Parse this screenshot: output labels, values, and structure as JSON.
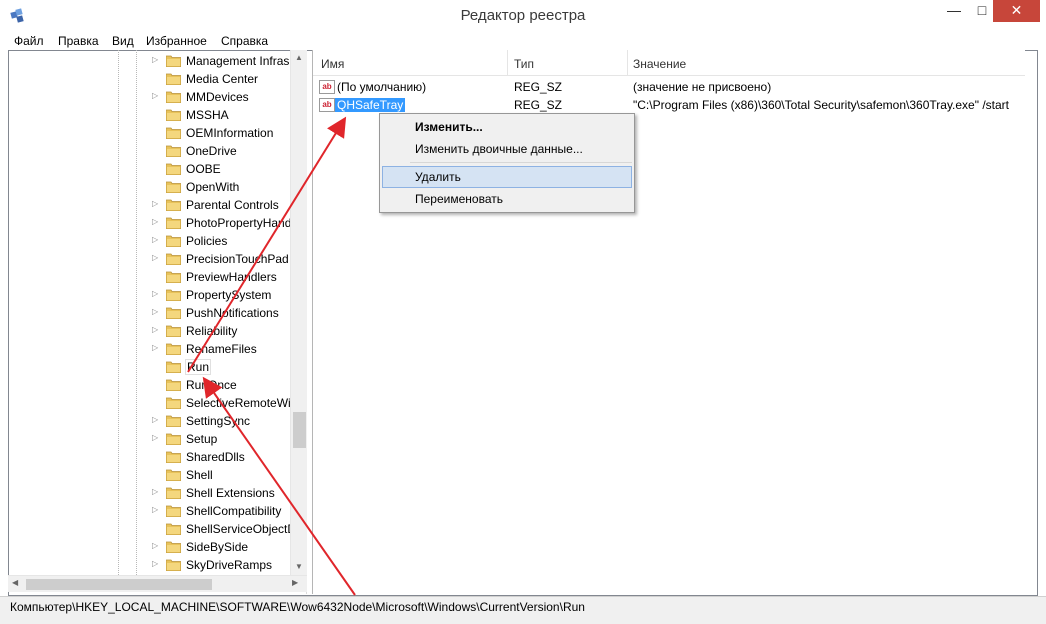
{
  "window": {
    "title": "Редактор реестра",
    "controls": {
      "minimize": "—",
      "maximize": "□",
      "close": "✕"
    }
  },
  "menu": [
    "Файл",
    "Правка",
    "Вид",
    "Избранное",
    "Справка"
  ],
  "tree": {
    "items": [
      {
        "label": "Management Infras",
        "expandable": true
      },
      {
        "label": "Media Center",
        "expandable": false
      },
      {
        "label": "MMDevices",
        "expandable": true
      },
      {
        "label": "MSSHA",
        "expandable": false
      },
      {
        "label": "OEMInformation",
        "expandable": false
      },
      {
        "label": "OneDrive",
        "expandable": false
      },
      {
        "label": "OOBE",
        "expandable": false
      },
      {
        "label": "OpenWith",
        "expandable": false
      },
      {
        "label": "Parental Controls",
        "expandable": true
      },
      {
        "label": "PhotoPropertyHand",
        "expandable": true
      },
      {
        "label": "Policies",
        "expandable": true
      },
      {
        "label": "PrecisionTouchPad",
        "expandable": true
      },
      {
        "label": "PreviewHandlers",
        "expandable": false
      },
      {
        "label": "PropertySystem",
        "expandable": true
      },
      {
        "label": "PushNotifications",
        "expandable": true
      },
      {
        "label": "Reliability",
        "expandable": true
      },
      {
        "label": "RenameFiles",
        "expandable": true
      },
      {
        "label": "Run",
        "expandable": false,
        "selected": true
      },
      {
        "label": "RunOnce",
        "expandable": false
      },
      {
        "label": "SelectiveRemoteWip",
        "expandable": false
      },
      {
        "label": "SettingSync",
        "expandable": true
      },
      {
        "label": "Setup",
        "expandable": true
      },
      {
        "label": "SharedDlls",
        "expandable": false
      },
      {
        "label": "Shell",
        "expandable": false
      },
      {
        "label": "Shell Extensions",
        "expandable": true
      },
      {
        "label": "ShellCompatibility",
        "expandable": true
      },
      {
        "label": "ShellServiceObjectD",
        "expandable": false
      },
      {
        "label": "SideBySide",
        "expandable": true
      },
      {
        "label": "SkyDriveRamps",
        "expandable": true
      }
    ]
  },
  "list": {
    "columns": [
      "Имя",
      "Тип",
      "Значение"
    ],
    "rows": [
      {
        "name": "(По умолчанию)",
        "type": "REG_SZ",
        "value": "(значение не присвоено)",
        "icon": "ab"
      },
      {
        "name": "QHSafeTray",
        "type": "REG_SZ",
        "value": "\"C:\\Program Files (x86)\\360\\Total Security\\safemon\\360Tray.exe\" /start",
        "icon": "ab",
        "selected": true
      }
    ]
  },
  "context_menu": {
    "items": [
      "Изменить...",
      "Изменить двоичные данные...",
      "Удалить",
      "Переименовать"
    ],
    "highlighted": "Удалить"
  },
  "status": "Компьютер\\HKEY_LOCAL_MACHINE\\SOFTWARE\\Wow6432Node\\Microsoft\\Windows\\CurrentVersion\\Run",
  "colors": {
    "selection": "#3399ff",
    "close_button": "#c7463a",
    "annotation_arrow": "#e0262b",
    "folder": "#e8c35a"
  }
}
